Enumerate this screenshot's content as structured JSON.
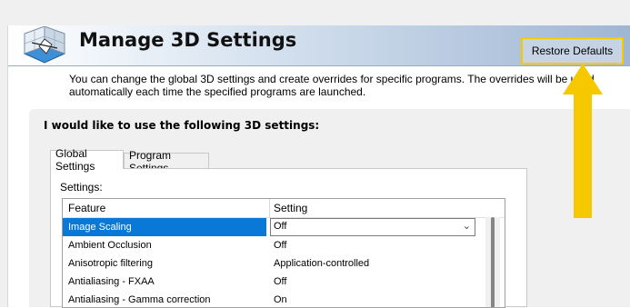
{
  "header": {
    "title": "Manage 3D Settings",
    "restore_label": "Restore Defaults",
    "description": "You can change the global 3D settings and create overrides for specific programs. The overrides will be used automatically each time the specified programs are launched.",
    "icon": "nvidia-3d-cube-icon"
  },
  "panel": {
    "heading": "I would like to use the following 3D settings:",
    "tabs": [
      {
        "label": "Global Settings",
        "active": true
      },
      {
        "label": "Program Settings",
        "active": false
      }
    ],
    "settings_label": "Settings:",
    "columns": {
      "feature": "Feature",
      "setting": "Setting"
    },
    "rows": [
      {
        "feature": "Image Scaling",
        "setting": "Off",
        "selected": true
      },
      {
        "feature": "Ambient Occlusion",
        "setting": "Off"
      },
      {
        "feature": "Anisotropic filtering",
        "setting": "Application-controlled"
      },
      {
        "feature": "Antialiasing - FXAA",
        "setting": "Off"
      },
      {
        "feature": "Antialiasing - Gamma correction",
        "setting": "On"
      }
    ]
  },
  "annotation": {
    "highlight_color": "#f5c800",
    "arrow_color": "#f5c800"
  },
  "colors": {
    "selection": "#0a78d7",
    "banner_end": "#9fb6d3"
  }
}
